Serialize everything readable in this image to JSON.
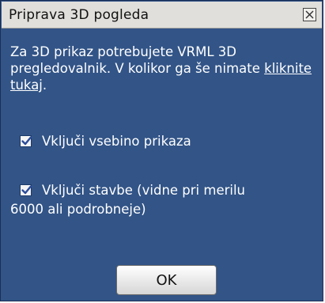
{
  "dialog": {
    "title": "Priprava 3D pogleda",
    "close_icon": "close-icon",
    "intro_text": "Za 3D prikaz potrebujete VRML 3D pregledovalnik. V kolikor ga še nimate ",
    "intro_link": "kliknite tukaj",
    "intro_end": ".",
    "options": [
      {
        "label": "Vključi vsebino prikaza",
        "checked": true
      },
      {
        "label_line1": "Vključi stavbe (vidne pri merilu",
        "label_line2": "6000 ali podrobneje)",
        "checked": true
      }
    ],
    "ok_label": "OK"
  },
  "colors": {
    "body_background": "#325487",
    "titlebar_background": "#e0dfdb",
    "check_mark": "#2a4c9a"
  }
}
